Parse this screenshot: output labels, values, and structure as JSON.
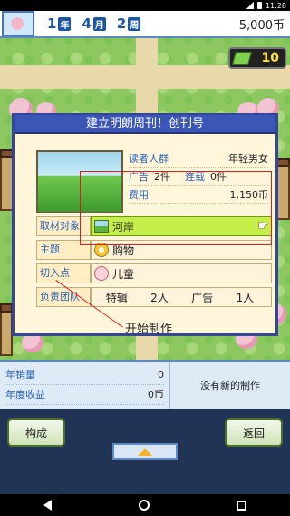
{
  "status_bar": {
    "time": "11:28"
  },
  "hud": {
    "year": "1",
    "year_unit": "年",
    "month": "4",
    "month_unit": "月",
    "week": "2",
    "week_unit": "周",
    "money": "5,000币"
  },
  "badge": {
    "count": "10"
  },
  "dialog": {
    "title": "建立明朗周刊！创刊号",
    "info": {
      "readers_label": "读者人群",
      "readers_value": "年轻男女",
      "ads_label": "广告",
      "ads_value": "2件",
      "serial_label": "连载",
      "serial_value": "0件",
      "cost_label": "费用",
      "cost_value": "1,150币"
    },
    "options": [
      {
        "label": "取材对象",
        "value": "河岸"
      },
      {
        "label": "主题",
        "value": "购物"
      },
      {
        "label": "切入点",
        "value": "儿童"
      }
    ],
    "team": {
      "label": "负责团队",
      "role1": "特辑",
      "count1": "2人",
      "role2": "广告",
      "count2": "1人"
    },
    "start_label": "开始制作"
  },
  "stats": {
    "sales_label": "年销量",
    "sales_value": "0",
    "income_label": "年度收益",
    "income_value": "0币",
    "message": "没有新的制作"
  },
  "buttons": {
    "compose": "构成",
    "back": "返回"
  },
  "colors": {
    "accent_blue": "#3c56b8",
    "selected_green": "#c6ee4a",
    "annotation_red": "#e31b1b"
  }
}
